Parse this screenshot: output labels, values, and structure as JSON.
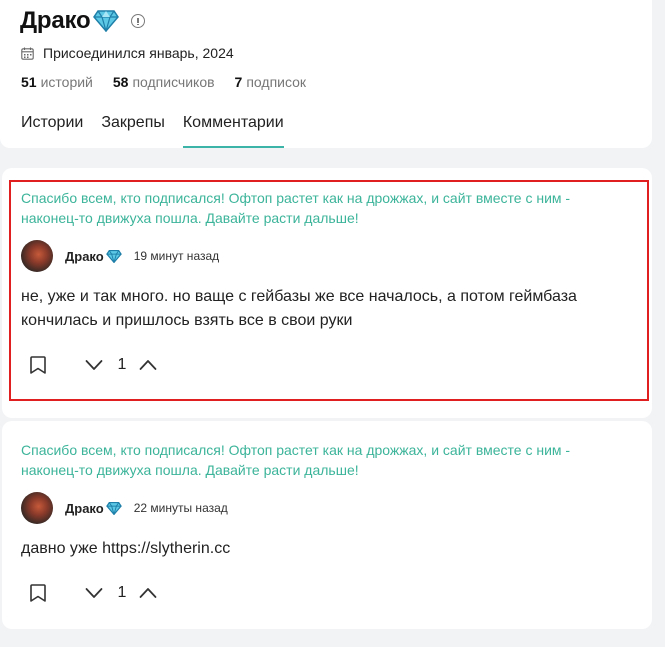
{
  "profile": {
    "name": "Драко",
    "joined": "Присоединился январь, 2024",
    "stats": [
      {
        "value": "51",
        "label": "историй"
      },
      {
        "value": "58",
        "label": "подписчиков"
      },
      {
        "value": "7",
        "label": "подписок"
      }
    ],
    "tabs": [
      {
        "label": "Истории",
        "active": false
      },
      {
        "label": "Закрепы",
        "active": false
      },
      {
        "label": "Комментарии",
        "active": true
      }
    ]
  },
  "comments": [
    {
      "post_title": "Спасибо всем, кто подписался! Офтоп растет как на дрожжах, и сайт вместе с ним - наконец-то движуха пошла. Давайте расти дальше!",
      "author": "Драко",
      "time": "19 минут назад",
      "text": "не, уже и так много. но ваще с гейбазы же все началось, а потом геймбаза кончилась и пришлось взять все в свои руки",
      "votes": "1",
      "highlighted": true
    },
    {
      "post_title": "Спасибо всем, кто подписался! Офтоп растет как на дрожжах, и сайт вместе с ним - наконец-то движуха пошла. Давайте расти дальше!",
      "author": "Драко",
      "time": "22 минуты назад",
      "text": "давно уже https://slytherin.cc",
      "votes": "1",
      "highlighted": false
    }
  ],
  "colors": {
    "accent": "#3cb4a8",
    "post_title": "#3cb49a",
    "highlight_border": "#e02020",
    "gem": "#3fb8d8"
  },
  "icons": [
    "diamond-icon",
    "info-icon",
    "calendar-icon",
    "bookmark-icon",
    "chevron-down-icon",
    "chevron-up-icon"
  ]
}
